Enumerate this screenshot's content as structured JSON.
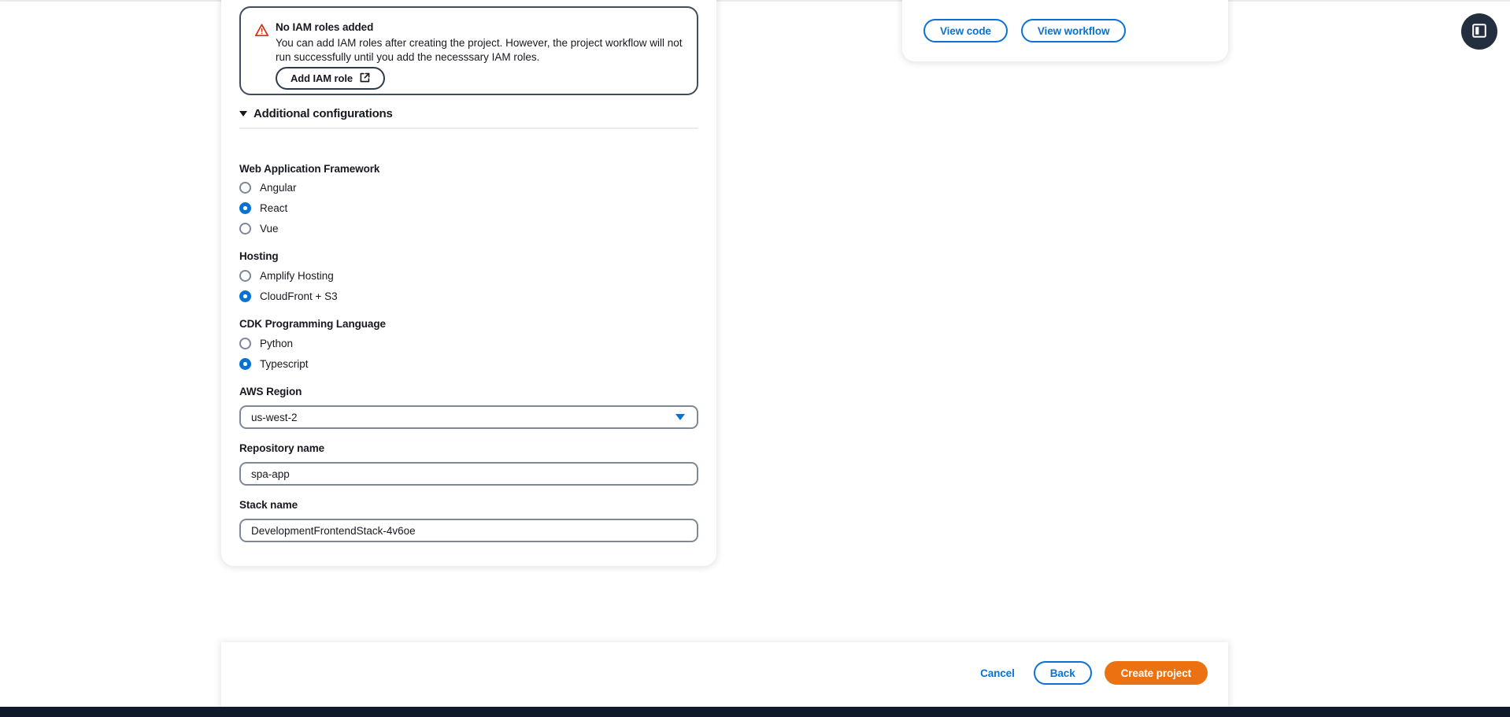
{
  "alert": {
    "icon": "warning-triangle-icon",
    "title": "No IAM roles added",
    "body": "You can add IAM roles after creating the project. However, the project workflow will not run successfully until you add the necesssary IAM roles.",
    "button_label": "Add IAM role",
    "button_icon": "external-link-icon",
    "border_color": "#414d5c",
    "icon_color": "#d13212"
  },
  "additional_configurations": {
    "title": "Additional configurations",
    "expanded": true,
    "caret_icon": "chevron-down-icon"
  },
  "web_application_framework": {
    "label": "Web Application Framework",
    "options": [
      {
        "label": "Angular",
        "selected": false
      },
      {
        "label": "React",
        "selected": true
      },
      {
        "label": "Vue",
        "selected": false
      }
    ]
  },
  "hosting": {
    "label": "Hosting",
    "options": [
      {
        "label": "Amplify Hosting",
        "selected": false
      },
      {
        "label": "CloudFront + S3",
        "selected": true
      }
    ]
  },
  "cdk_programming_language": {
    "label": "CDK Programming Language",
    "options": [
      {
        "label": "Python",
        "selected": false
      },
      {
        "label": "Typescript",
        "selected": true
      }
    ]
  },
  "aws_region": {
    "label": "AWS Region",
    "value": "us-west-2",
    "caret_icon": "caret-down-icon"
  },
  "repository_name": {
    "label": "Repository name",
    "value": "spa-app"
  },
  "stack_name": {
    "label": "Stack name",
    "value": "DevelopmentFrontendStack-4v6oe"
  },
  "side_panel": {
    "view_code_label": "View code",
    "view_workflow_label": "View workflow"
  },
  "footer": {
    "cancel_label": "Cancel",
    "back_label": "Back",
    "create_label": "Create project",
    "primary_color": "#ec7211",
    "link_color": "#0972d3"
  },
  "float_toggle": {
    "icon": "panel-toggle-icon",
    "background": "#232f3e"
  },
  "theme": {
    "accent_blue": "#0972d3",
    "text_dark": "#16191f",
    "border_grey": "#7d8998",
    "divider_grey": "#e9ebed"
  }
}
